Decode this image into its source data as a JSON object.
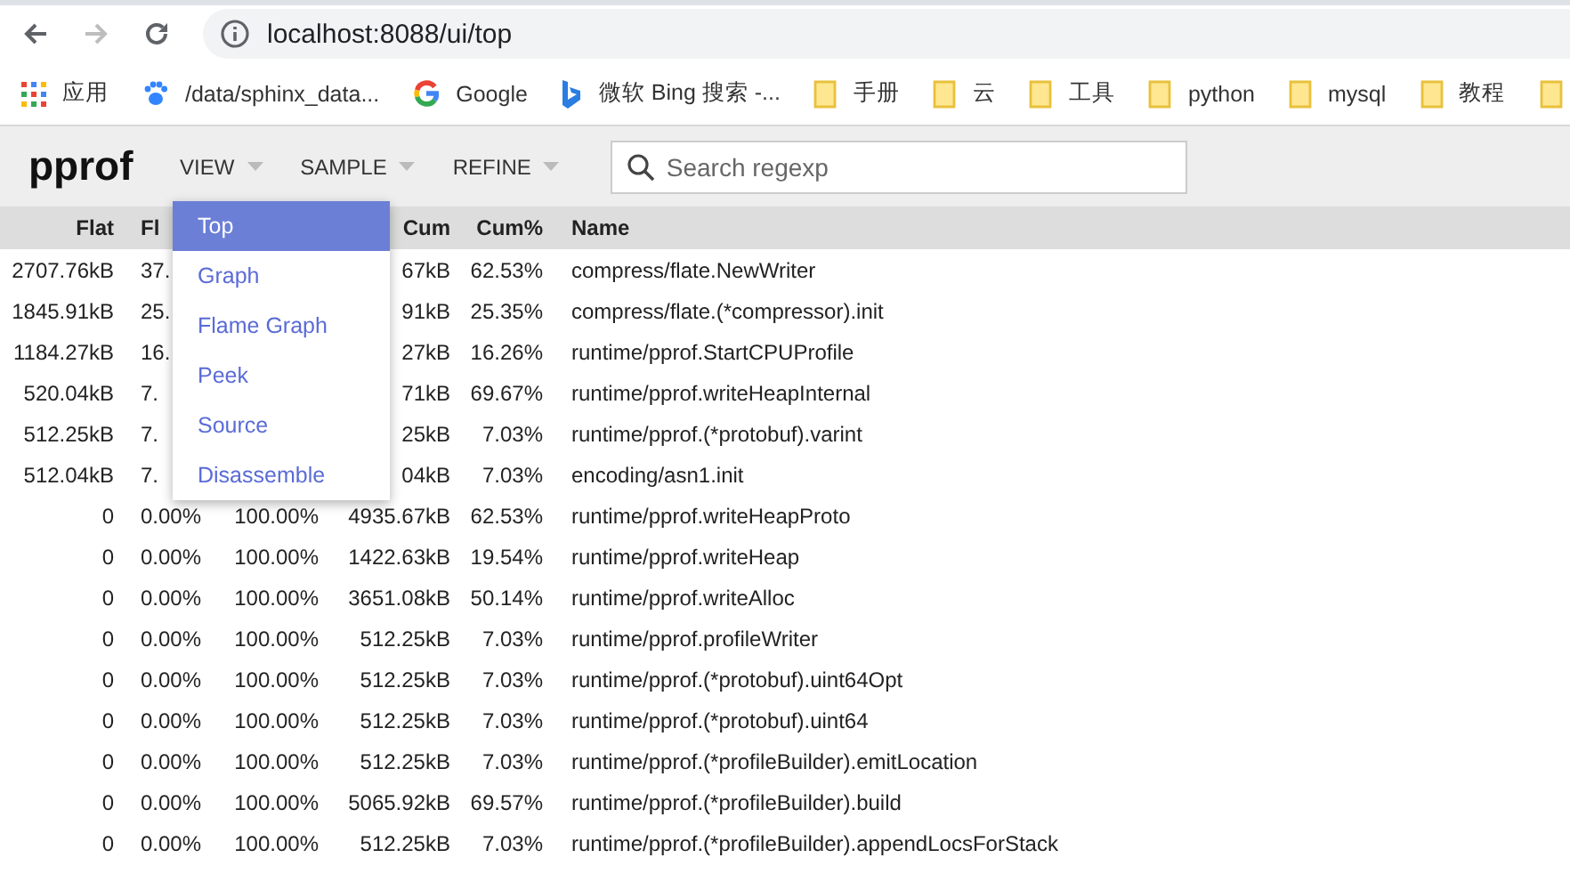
{
  "browser": {
    "url": "localhost:8088/ui/top",
    "bookmarks": [
      {
        "kind": "apps",
        "label": "应用"
      },
      {
        "kind": "paw",
        "label": "/data/sphinx_data..."
      },
      {
        "kind": "google",
        "label": "Google"
      },
      {
        "kind": "bing",
        "label": "微软 Bing 搜索 -..."
      },
      {
        "kind": "folder",
        "label": "手册"
      },
      {
        "kind": "folder",
        "label": "云"
      },
      {
        "kind": "folder",
        "label": "工具"
      },
      {
        "kind": "folder",
        "label": "python"
      },
      {
        "kind": "folder",
        "label": "mysql"
      },
      {
        "kind": "folder",
        "label": "教程"
      },
      {
        "kind": "folder"
      }
    ]
  },
  "app": {
    "title": "pprof",
    "menus": [
      {
        "label": "VIEW",
        "items": [
          {
            "label": "Top",
            "selected": true
          },
          {
            "label": "Graph",
            "selected": false
          },
          {
            "label": "Flame Graph",
            "selected": false
          },
          {
            "label": "Peek",
            "selected": false
          },
          {
            "label": "Source",
            "selected": false
          },
          {
            "label": "Disassemble",
            "selected": false
          }
        ]
      },
      {
        "label": "SAMPLE"
      },
      {
        "label": "REFINE"
      }
    ],
    "search": {
      "placeholder": "Search regexp"
    }
  },
  "table": {
    "columns": {
      "flat": "Flat",
      "flat_pct": "Fl",
      "cum": "Cum",
      "cum_pct": "Cum%",
      "name": "Name"
    },
    "rows": [
      {
        "flat": "2707.76kB",
        "flat_pct": "37.",
        "cum": "67kB",
        "cum_pct": "62.53%",
        "name": "compress/flate.NewWriter"
      },
      {
        "flat": "1845.91kB",
        "flat_pct": "25.",
        "cum": "91kB",
        "cum_pct": "25.35%",
        "name": "compress/flate.(*compressor).init"
      },
      {
        "flat": "1184.27kB",
        "flat_pct": "16.",
        "cum": "27kB",
        "cum_pct": "16.26%",
        "name": "runtime/pprof.StartCPUProfile"
      },
      {
        "flat": "520.04kB",
        "flat_pct": "7.",
        "cum": "71kB",
        "cum_pct": "69.67%",
        "name": "runtime/pprof.writeHeapInternal"
      },
      {
        "flat": "512.25kB",
        "flat_pct": "7.",
        "cum": "25kB",
        "cum_pct": "7.03%",
        "name": "runtime/pprof.(*protobuf).varint"
      },
      {
        "flat": "512.04kB",
        "flat_pct": "7.",
        "cum": "04kB",
        "cum_pct": "7.03%",
        "name": "encoding/asn1.init"
      },
      {
        "flat": "0",
        "flat_pct": "0.00%",
        "sum_pct": "100.00%",
        "cum": "4935.67kB",
        "cum_pct": "62.53%",
        "name": "runtime/pprof.writeHeapProto"
      },
      {
        "flat": "0",
        "flat_pct": "0.00%",
        "sum_pct": "100.00%",
        "cum": "1422.63kB",
        "cum_pct": "19.54%",
        "name": "runtime/pprof.writeHeap"
      },
      {
        "flat": "0",
        "flat_pct": "0.00%",
        "sum_pct": "100.00%",
        "cum": "3651.08kB",
        "cum_pct": "50.14%",
        "name": "runtime/pprof.writeAlloc"
      },
      {
        "flat": "0",
        "flat_pct": "0.00%",
        "sum_pct": "100.00%",
        "cum": "512.25kB",
        "cum_pct": "7.03%",
        "name": "runtime/pprof.profileWriter"
      },
      {
        "flat": "0",
        "flat_pct": "0.00%",
        "sum_pct": "100.00%",
        "cum": "512.25kB",
        "cum_pct": "7.03%",
        "name": "runtime/pprof.(*protobuf).uint64Opt"
      },
      {
        "flat": "0",
        "flat_pct": "0.00%",
        "sum_pct": "100.00%",
        "cum": "512.25kB",
        "cum_pct": "7.03%",
        "name": "runtime/pprof.(*protobuf).uint64"
      },
      {
        "flat": "0",
        "flat_pct": "0.00%",
        "sum_pct": "100.00%",
        "cum": "512.25kB",
        "cum_pct": "7.03%",
        "name": "runtime/pprof.(*profileBuilder).emitLocation"
      },
      {
        "flat": "0",
        "flat_pct": "0.00%",
        "sum_pct": "100.00%",
        "cum": "5065.92kB",
        "cum_pct": "69.57%",
        "name": "runtime/pprof.(*profileBuilder).build"
      },
      {
        "flat": "0",
        "flat_pct": "0.00%",
        "sum_pct": "100.00%",
        "cum": "512.25kB",
        "cum_pct": "7.03%",
        "name": "runtime/pprof.(*profileBuilder).appendLocsForStack"
      }
    ]
  }
}
